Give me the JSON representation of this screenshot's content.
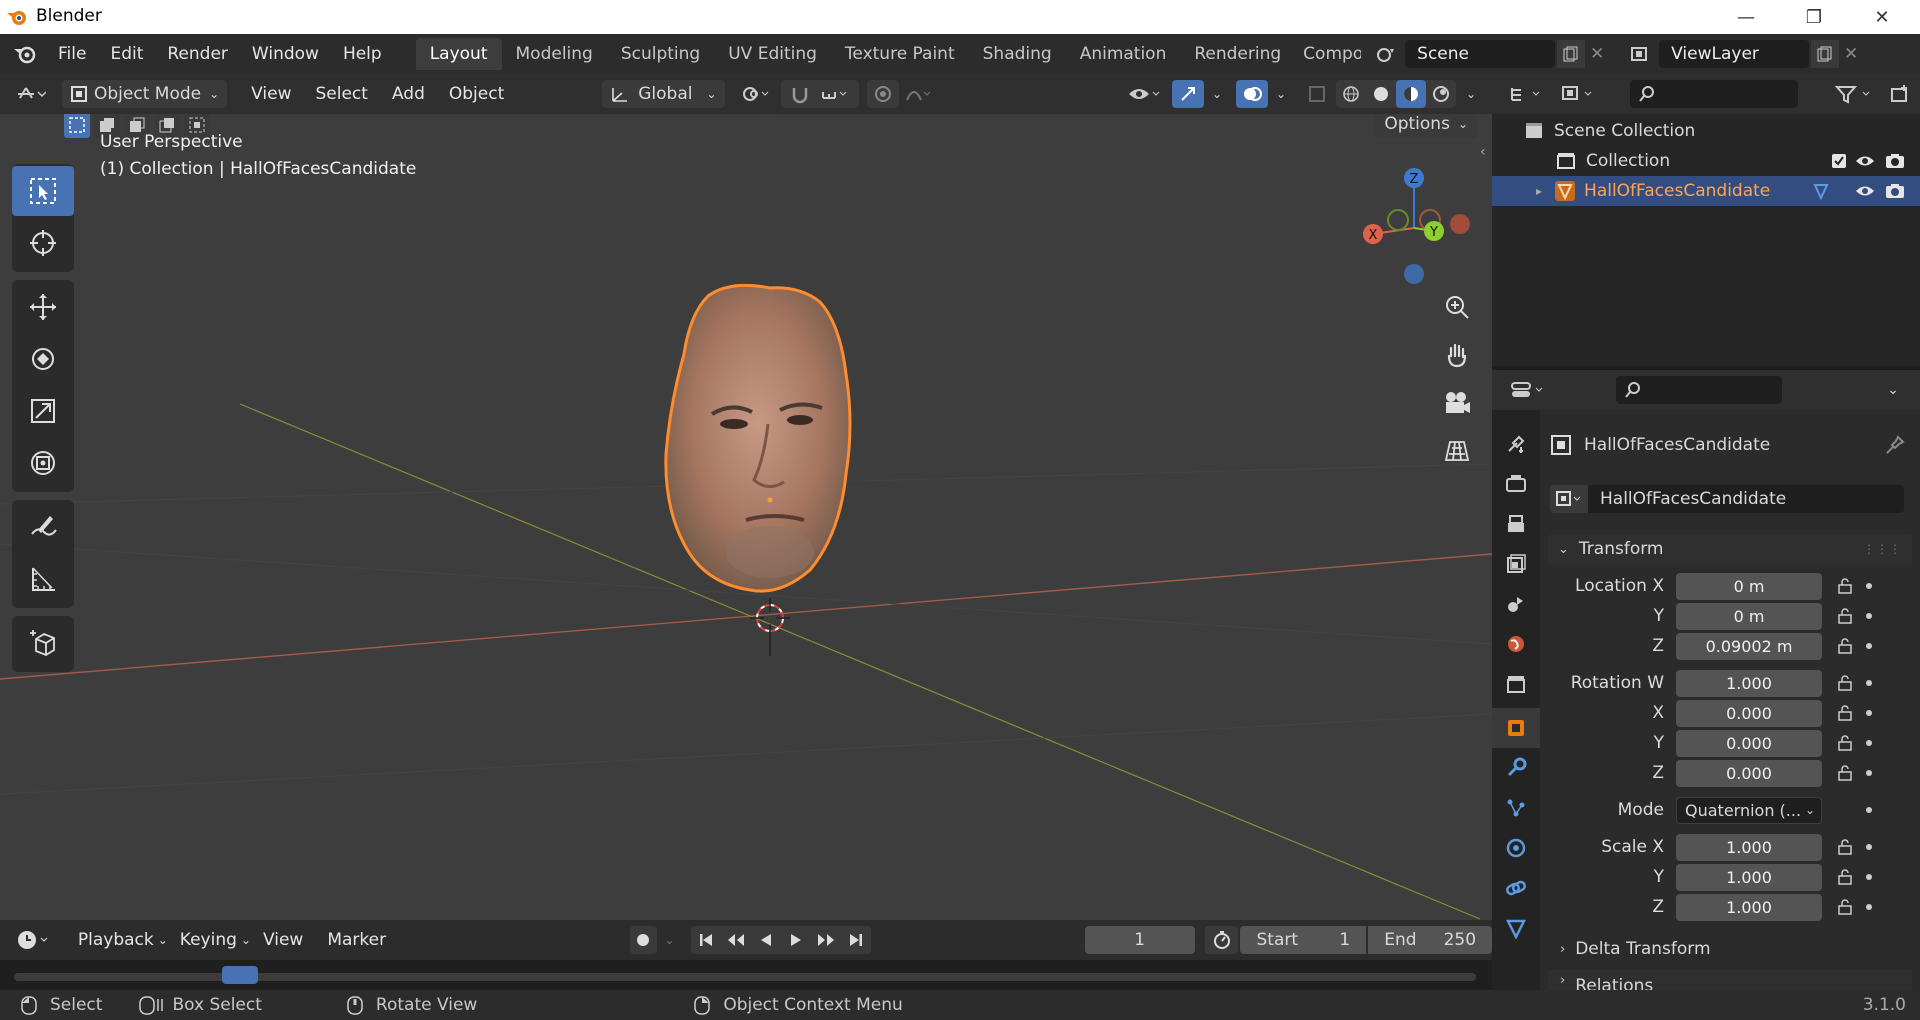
{
  "titlebar": {
    "app_title": "Blender",
    "minimize": "—",
    "restore": "❐",
    "close": "✕"
  },
  "menus": [
    "File",
    "Edit",
    "Render",
    "Window",
    "Help"
  ],
  "workspace_tabs": [
    "Layout",
    "Modeling",
    "Sculpting",
    "UV Editing",
    "Texture Paint",
    "Shading",
    "Animation",
    "Rendering",
    "Compo"
  ],
  "active_workspace": "Layout",
  "scene_field": "Scene",
  "viewlayer_field": "ViewLayer",
  "viewport_header": {
    "mode": "Object Mode",
    "menus": [
      "View",
      "Select",
      "Add",
      "Object"
    ],
    "orientation": "Global",
    "options_label": "Options"
  },
  "viewport": {
    "perspective_label": "User Perspective",
    "collection_label": "(1) Collection | HallOfFacesCandidate",
    "gizmo_axes": {
      "x": "X",
      "y": "Y",
      "z": "Z"
    }
  },
  "outliner": {
    "scene_collection": "Scene Collection",
    "collection": "Collection",
    "object": "HallOfFacesCandidate"
  },
  "properties": {
    "object_name": "HallOfFacesCandidate",
    "datablock_name": "HallOfFacesCandidate",
    "transform_label": "Transform",
    "location_x_label": "Location X",
    "location_x": "0 m",
    "location_y_label": "Y",
    "location_y": "0 m",
    "location_z_label": "Z",
    "location_z": "0.09002 m",
    "rotation_w_label": "Rotation W",
    "rotation_w": "1.000",
    "rotation_x_label": "X",
    "rotation_x": "0.000",
    "rotation_y_label": "Y",
    "rotation_y": "0.000",
    "rotation_z_label": "Z",
    "rotation_z": "0.000",
    "mode_label": "Mode",
    "mode_value": "Quaternion (...",
    "scale_x_label": "Scale X",
    "scale_x": "1.000",
    "scale_y_label": "Y",
    "scale_y": "1.000",
    "scale_z_label": "Z",
    "scale_z": "1.000",
    "delta_transform": "Delta Transform",
    "relations": "Relations"
  },
  "timeline": {
    "menus": [
      "Playback",
      "Keying",
      "View",
      "Marker"
    ],
    "current_frame": "1",
    "start_label": "Start",
    "start_value": "1",
    "end_label": "End",
    "end_value": "250"
  },
  "statusbar": {
    "select": "Select",
    "box_select": "Box Select",
    "rotate_view": "Rotate View",
    "context_menu": "Object Context Menu",
    "version": "3.1.0"
  },
  "colors": {
    "accent_blue": "#4772b3",
    "selection_orange": "#ff8c2e",
    "axis_x": "#e0604a",
    "axis_y": "#8ccf2e",
    "axis_z": "#3f7ad0"
  }
}
